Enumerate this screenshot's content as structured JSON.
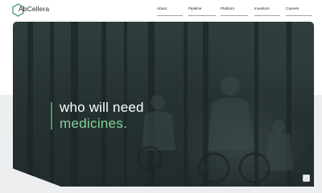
{
  "brand": {
    "logo_text": "AbCellera",
    "accent_color": "#4e9a6b"
  },
  "nav": {
    "items": [
      {
        "label": "About"
      },
      {
        "label": "Pipeline"
      },
      {
        "label": "Platform"
      },
      {
        "label": "Investors"
      },
      {
        "label": "Careers"
      }
    ]
  },
  "hero": {
    "headline_line1": "who will need",
    "headline_line2": "medicines.",
    "headline_line2_color": "#7fd39a",
    "background": "forest-cyclists-photo",
    "pause_icon": "pause-icon"
  }
}
